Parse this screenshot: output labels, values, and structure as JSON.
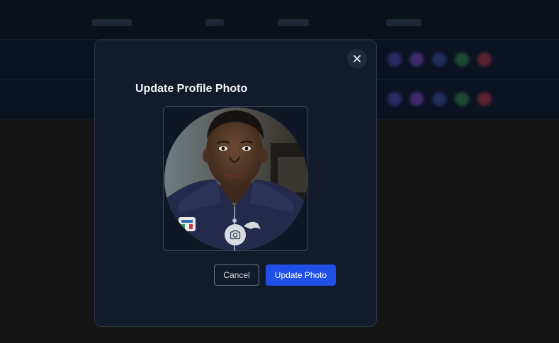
{
  "modal": {
    "title": "Update Profile Photo",
    "close_icon": "close-icon",
    "camera_icon": "camera-icon",
    "cancel_label": "Cancel",
    "update_label": "Update Photo"
  },
  "colors": {
    "modal_bg": "#121b2c",
    "primary_button": "#1f51e8",
    "page_bg": "#161616"
  }
}
